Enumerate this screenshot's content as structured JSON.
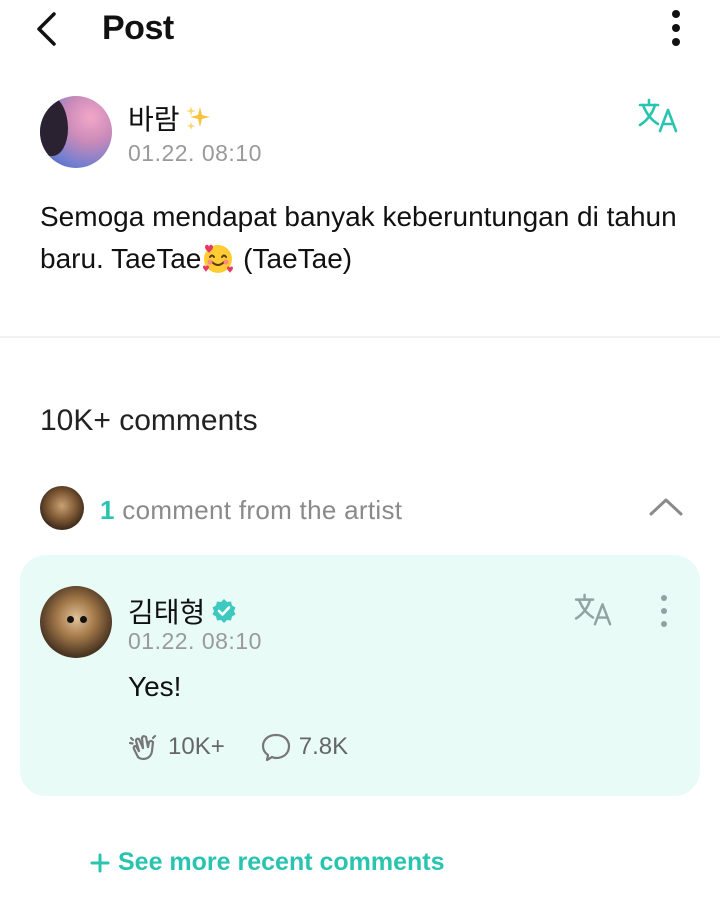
{
  "header": {
    "title": "Post",
    "back_icon": "chevron-left-icon",
    "more_icon": "more-vertical-icon"
  },
  "post": {
    "author": "바람",
    "author_badge_icon": "sparkles-icon",
    "timestamp": "01.22. 08:10",
    "translate_icon": "translate-icon",
    "body_before_emoji": "Semoga mendapat banyak keberuntungan di tahun baru. TaeTae",
    "body_emoji_icon": "smiling-face-with-hearts-icon",
    "body_after_emoji": " (TaeTae)"
  },
  "comments": {
    "count_label": "10K+ comments",
    "artist_section": {
      "count": "1",
      "label": " comment from the artist",
      "collapse_icon": "chevron-up-icon"
    },
    "artist_comment": {
      "author": "김태형",
      "verified_icon": "verified-badge-icon",
      "timestamp": "01.22. 08:10",
      "body": "Yes!",
      "like_count": "10K+",
      "reply_count": "7.8K"
    },
    "see_more_label": "See more recent comments"
  },
  "colors": {
    "accent": "#29c4b0",
    "artist_card_bg": "#e8fbf7",
    "muted_text": "#9a9a9a"
  }
}
